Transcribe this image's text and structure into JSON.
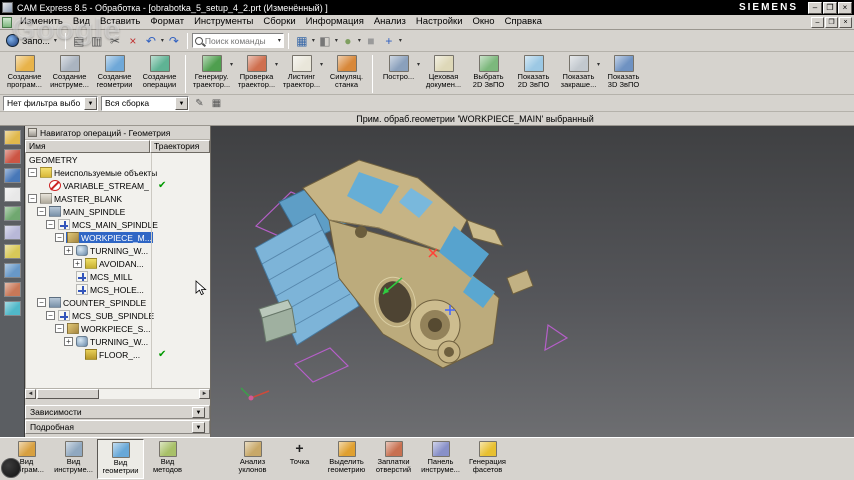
{
  "watermark": {
    "text": "Google"
  },
  "title_bar": {
    "title": "CAM Express 8.5 - Обработка - [obrabotka_5_setup_4_2.prt (Изменённый) ]",
    "brand": "SIEMENS",
    "window_buttons": {
      "minimize": "–",
      "maximize": "❐",
      "close": "×"
    }
  },
  "menu_bar": {
    "items": [
      "Изменить",
      "Вид",
      "Вставить",
      "Формат",
      "Инструменты",
      "Сборки",
      "Информация",
      "Анализ",
      "Настройки",
      "Окно",
      "Справка"
    ],
    "window_buttons": {
      "minimize": "–",
      "restore": "❐",
      "close": "×"
    }
  },
  "toolbar_top": {
    "start_button": {
      "label": "Запо...",
      "arrow": "▾"
    },
    "left_icons": [
      {
        "name": "print-icon",
        "glyph": "▤",
        "color": "#555"
      },
      {
        "name": "copy-icon",
        "glyph": "▥",
        "color": "#555"
      },
      {
        "name": "cut-icon",
        "glyph": "✂",
        "color": "#555"
      },
      {
        "name": "delete-icon",
        "glyph": "×",
        "color": "#c03030"
      },
      {
        "name": "undo-icon",
        "glyph": "↶",
        "color": "#3060c0",
        "arrow": true
      },
      {
        "name": "redo-icon",
        "glyph": "↷",
        "color": "#3060c0"
      }
    ],
    "search": {
      "placeholder": "Поиск команды"
    },
    "right_icons": [
      {
        "name": "window-layout-icon",
        "glyph": "▦",
        "color": "#3868a8",
        "arrow": true
      },
      {
        "name": "view-orient-icon",
        "glyph": "◧",
        "color": "#777",
        "arrow": true
      },
      {
        "name": "rendering-style-icon",
        "glyph": "●",
        "color": "#7f9f60",
        "arrow": true
      },
      {
        "name": "background-icon",
        "glyph": "■",
        "color": "#9a9a9a"
      },
      {
        "name": "csys-display-icon",
        "glyph": "+",
        "color": "#3060c0",
        "arrow": true
      }
    ]
  },
  "ribbon": {
    "buttons": [
      {
        "name": "create-program-button",
        "label": "Создание\nпрограм...",
        "color": "#e8b34a"
      },
      {
        "name": "create-tool-button",
        "label": "Создание\nинструме...",
        "color": "#aab4c0"
      },
      {
        "name": "create-geometry-button",
        "label": "Создание\nгеометрии",
        "color": "#6fa8d8"
      },
      {
        "name": "create-operation-button",
        "label": "Создание\nоперации",
        "color": "#5fb394"
      },
      {
        "sep": true
      },
      {
        "name": "generate-toolpath-button",
        "label": "Генериру.\nтраектор...",
        "color": "#4f9f4f",
        "arrow": true
      },
      {
        "name": "verify-toolpath-button",
        "label": "Проверка\nтраектор...",
        "color": "#cf6f4f",
        "arrow": true
      },
      {
        "name": "list-toolpath-button",
        "label": "Листинг\nтраектор...",
        "color": "#e9e6da",
        "arrow": true
      },
      {
        "name": "machine-simulation-button",
        "label": "Симуляц.\nстанка",
        "color": "#d8883a"
      },
      {
        "sep": true
      },
      {
        "name": "post-button",
        "label": "Постро...",
        "color": "#8aa0bc",
        "arrow": true
      },
      {
        "name": "shop-docs-button",
        "label": "Цеховая\nдокумен...",
        "color": "#ded8b8"
      },
      {
        "name": "select-2d-ipw-button",
        "label": "Выбрать\n2D ЗвПО",
        "color": "#7cb87c"
      },
      {
        "name": "show-2d-ipw-button",
        "label": "Показать\n2D ЗвПО",
        "color": "#9cc8e4"
      },
      {
        "name": "show-shaded-ipw-button",
        "label": "Показать\nзакраше...",
        "color": "#c2c8ce",
        "arrow": true
      },
      {
        "name": "show-3d-ipw-button",
        "label": "Показать\n3D ЗвПО",
        "color": "#6f92c2"
      }
    ]
  },
  "filter_bar": {
    "filter_select": "Нет фильтра выбо",
    "scope_select": "Вся сборка",
    "icons": [
      {
        "name": "edit-filter-icon",
        "glyph": "✎"
      },
      {
        "name": "snap-point-icon",
        "glyph": "▦"
      }
    ]
  },
  "prompt_bar": {
    "text": "Прим. обраб.геометрии 'WORKPIECE_MAIN' выбранный"
  },
  "resource_bar": {
    "icons": [
      {
        "name": "assembly-navigator-icon",
        "color": "#e0b84c"
      },
      {
        "name": "positioning-navigator-icon",
        "color": "#cc5544"
      },
      {
        "name": "part-navigator-icon",
        "color": "#4878b8"
      },
      {
        "name": "operation-navigator-icon",
        "color": "#e8e8e8"
      },
      {
        "name": "machine-navigator-icon",
        "color": "#70a870"
      },
      {
        "name": "reuse-library-icon",
        "color": "#b8b8d8"
      },
      {
        "name": "web-browser-icon",
        "color": "#d8c858"
      },
      {
        "name": "history-icon",
        "color": "#6898c8"
      },
      {
        "name": "palettes-icon",
        "color": "#c87858"
      },
      {
        "name": "roles-icon",
        "color": "#50b8c8"
      }
    ]
  },
  "navigator": {
    "title": "Навигатор операций - Геометрия",
    "columns": [
      "Имя",
      "Траектория"
    ],
    "check_glyph": "✔",
    "hscroll": {
      "left": "◄",
      "right": "►"
    },
    "rows": [
      {
        "label": "GEOMETRY",
        "depth": 0
      },
      {
        "label": "Неиспользуемые объекты",
        "depth": 0,
        "expander": "minus",
        "icon": "unused-folder-icon"
      },
      {
        "label": "VARIABLE_STREAM_",
        "depth": 1,
        "icon": "prohibited-icon",
        "check": true
      },
      {
        "label": "MASTER_BLANK",
        "depth": 0,
        "expander": "minus",
        "icon": "blank-icon"
      },
      {
        "label": "MAIN_SPINDLE",
        "depth": 1,
        "expander": "minus",
        "icon": "spindle-icon"
      },
      {
        "label": "MCS_MAIN_SPINDLE",
        "depth": 2,
        "expander": "minus",
        "icon": "mcs-icon"
      },
      {
        "label": "WORKPIECE_M...",
        "depth": 3,
        "expander": "minus",
        "icon": "workpiece-icon",
        "selected": true
      },
      {
        "label": "TURNING_W...",
        "depth": 4,
        "expander": "plus",
        "icon": "turning-icon"
      },
      {
        "label": "AVOIDAN...",
        "depth": 5,
        "expander": "plus",
        "icon": "avoidance-icon"
      },
      {
        "label": "MCS_MILL",
        "depth": 4,
        "icon": "mcs-icon"
      },
      {
        "label": "MCS_HOLE...",
        "depth": 4,
        "icon": "mcs-icon"
      },
      {
        "label": "COUNTER_SPINDLE",
        "depth": 1,
        "expander": "minus",
        "icon": "spindle-icon"
      },
      {
        "label": "MCS_SUB_SPINDLE",
        "depth": 2,
        "expander": "minus",
        "icon": "mcs-icon"
      },
      {
        "label": "WORKPIECE_S...",
        "depth": 3,
        "expander": "minus",
        "icon": "workpiece-icon"
      },
      {
        "label": "TURNING_W...",
        "depth": 4,
        "expander": "plus",
        "icon": "turning-icon"
      },
      {
        "label": "FLOOR_...",
        "depth": 5,
        "icon": "floor-icon",
        "check": true
      }
    ],
    "sections": [
      "Зависимости",
      "Подробная"
    ]
  },
  "bottom_toolbar": {
    "buttons": [
      {
        "name": "program-order-view-button",
        "label": "Вид\nпрограм...",
        "color": "#d8a040"
      },
      {
        "name": "machine-tool-view-button",
        "label": "Вид\nинструме...",
        "color": "#90a8c0"
      },
      {
        "name": "geometry-view-button",
        "label": "Вид\nгеометрии",
        "color": "#68a8d8",
        "active": true
      },
      {
        "name": "machining-method-view-button",
        "label": "Вид\nметодов",
        "color": "#a8c068"
      },
      {
        "gap": true
      },
      {
        "name": "draft-analysis-button",
        "label": "Анализ\nуклонов",
        "color": "#c8a868"
      },
      {
        "name": "point-button",
        "label": "Точка",
        "glyph": "+"
      },
      {
        "name": "select-geometry-button",
        "label": "Выделить\nгеометрию",
        "color": "#e0a030"
      },
      {
        "name": "hole-patches-button",
        "label": "Заплатки\nотверстий",
        "color": "#c87050"
      },
      {
        "name": "tool-panel-button",
        "label": "Панель\nинструме...",
        "color": "#8890c8"
      },
      {
        "name": "facet-generation-button",
        "label": "Генерация\nфасетов",
        "color": "#e8c030"
      }
    ]
  },
  "viewport": {
    "background_top": "#3f4042",
    "background_bottom": "#6d6e71",
    "part_color": "#c6b485",
    "machined_face_color": "#7db4d8",
    "plane_edge_color": "#b55fc8",
    "axis_x_color": "#ff4136",
    "axis_y_color": "#2ecc40",
    "axis_z_color": "#4466ff"
  }
}
